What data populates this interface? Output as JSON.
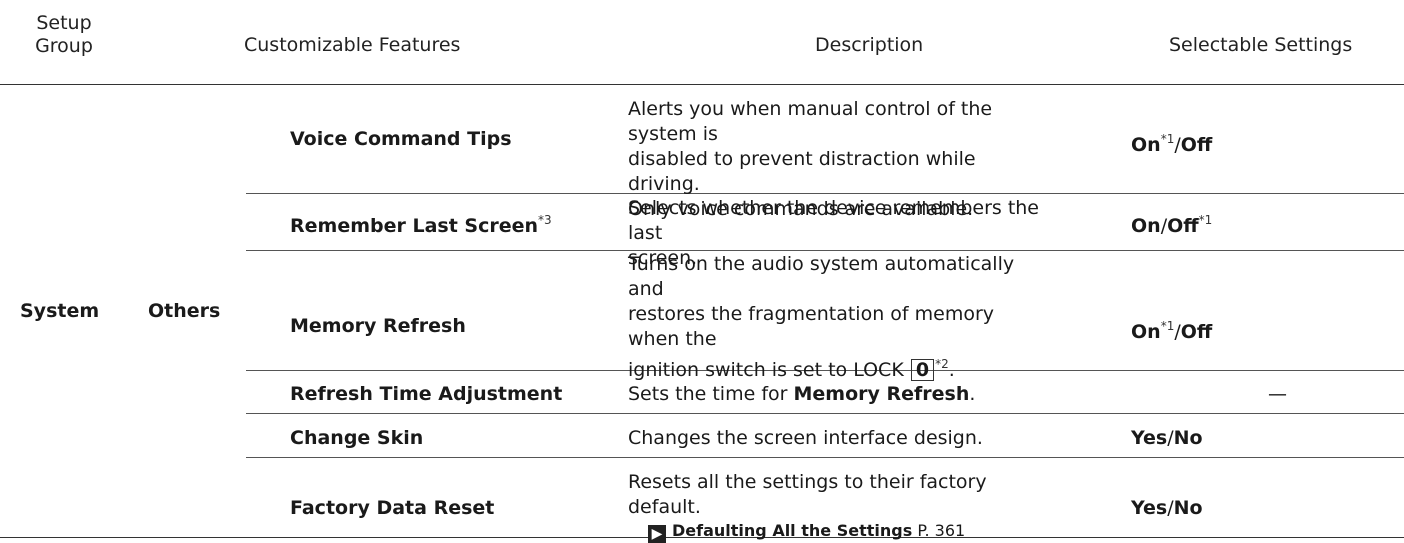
{
  "header": {
    "col1_line1": "Setup",
    "col1_line2": "Group",
    "col2": "Customizable Features",
    "col3": "Description",
    "col4": "Selectable Settings"
  },
  "group": {
    "name": "System",
    "subgroup": "Others"
  },
  "rows": [
    {
      "feature": "Voice Command Tips",
      "desc_lines": [
        "Alerts you when manual control of the system is",
        "disabled to prevent distraction while driving.",
        "Only voice commands are available."
      ],
      "setting_a": "On",
      "note_a": "*1",
      "sep": "/",
      "setting_b": "Off",
      "note_b": ""
    },
    {
      "feature": "Remember Last Screen",
      "feature_note": "*3",
      "desc_lines": [
        "Selects whether the device remembers the last",
        "screen."
      ],
      "setting_a": "On",
      "note_a": "",
      "sep": "/",
      "setting_b": "Off",
      "note_b": "*1"
    },
    {
      "feature": "Memory Refresh",
      "desc_lines": [
        "Turns on the audio system automatically and",
        "restores the fragmentation of memory when the"
      ],
      "desc_line3_pre": "ignition switch is set to LOCK ",
      "desc_key": "0",
      "desc_key_note": "*2",
      "desc_line3_post": ".",
      "setting_a": "On",
      "note_a": "*1",
      "sep": "/",
      "setting_b": "Off",
      "note_b": ""
    },
    {
      "feature": "Refresh Time Adjustment",
      "desc_pre": "Sets the time for ",
      "desc_bold": "Memory Refresh",
      "desc_post": ".",
      "setting_dash": "—"
    },
    {
      "feature": "Change Skin",
      "desc_lines": [
        "Changes the screen interface design."
      ],
      "setting_a": "Yes",
      "sep": "/",
      "setting_b": "No"
    },
    {
      "feature": "Factory Data Reset",
      "desc_lines": [
        "Resets all the settings to their factory default."
      ],
      "link_text": "Defaulting All the Settings",
      "link_page": "P. 361",
      "setting_a": "Yes",
      "sep": "/",
      "setting_b": "No"
    }
  ]
}
